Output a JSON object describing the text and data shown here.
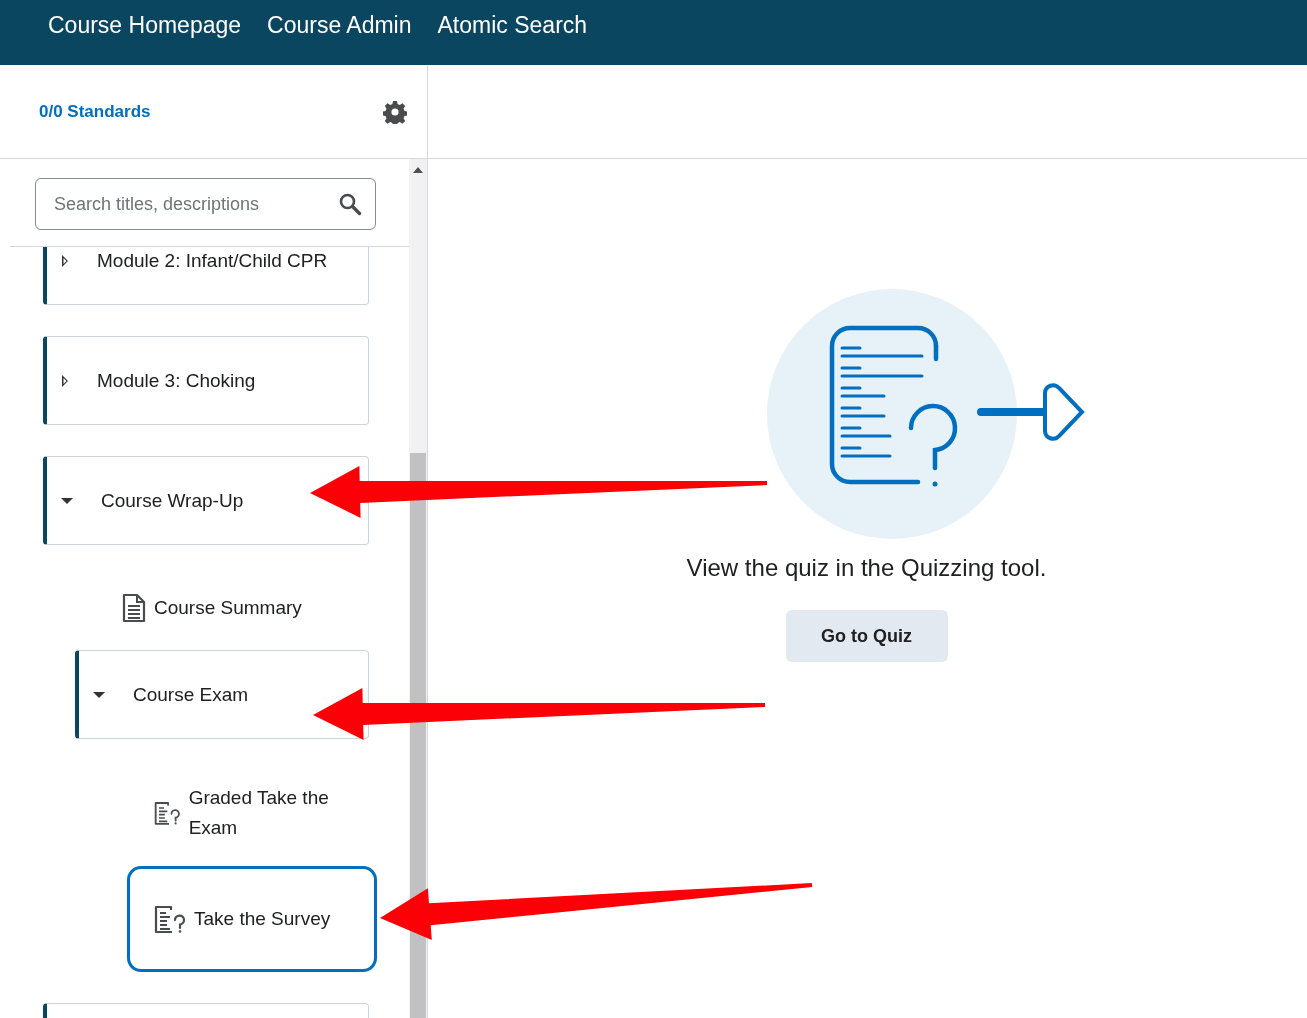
{
  "top_nav": {
    "links": [
      "Course Homepage",
      "Course Admin",
      "Atomic Search"
    ]
  },
  "sidebar": {
    "standards_link": "0/0 Standards",
    "search": {
      "placeholder": "Search titles, descriptions"
    },
    "items": [
      {
        "kind": "module",
        "title": "Module 2: Infant/Child CPR",
        "expanded": false
      },
      {
        "kind": "module",
        "title": "Module 3: Choking",
        "expanded": false
      },
      {
        "kind": "module",
        "title": "Course Wrap-Up",
        "expanded": true,
        "children": [
          {
            "kind": "document",
            "title": "Course Summary",
            "selected": false
          },
          {
            "kind": "module",
            "title": "Course Exam",
            "expanded": true,
            "children": [
              {
                "kind": "quiz",
                "title": "Graded Take the Exam",
                "selected": false
              },
              {
                "kind": "quiz",
                "title": "Take the Survey",
                "selected": true
              }
            ]
          }
        ]
      },
      {
        "kind": "module"
      }
    ]
  },
  "content": {
    "message": "View the quiz in the Quizzing tool.",
    "button": "Go to Quiz"
  }
}
